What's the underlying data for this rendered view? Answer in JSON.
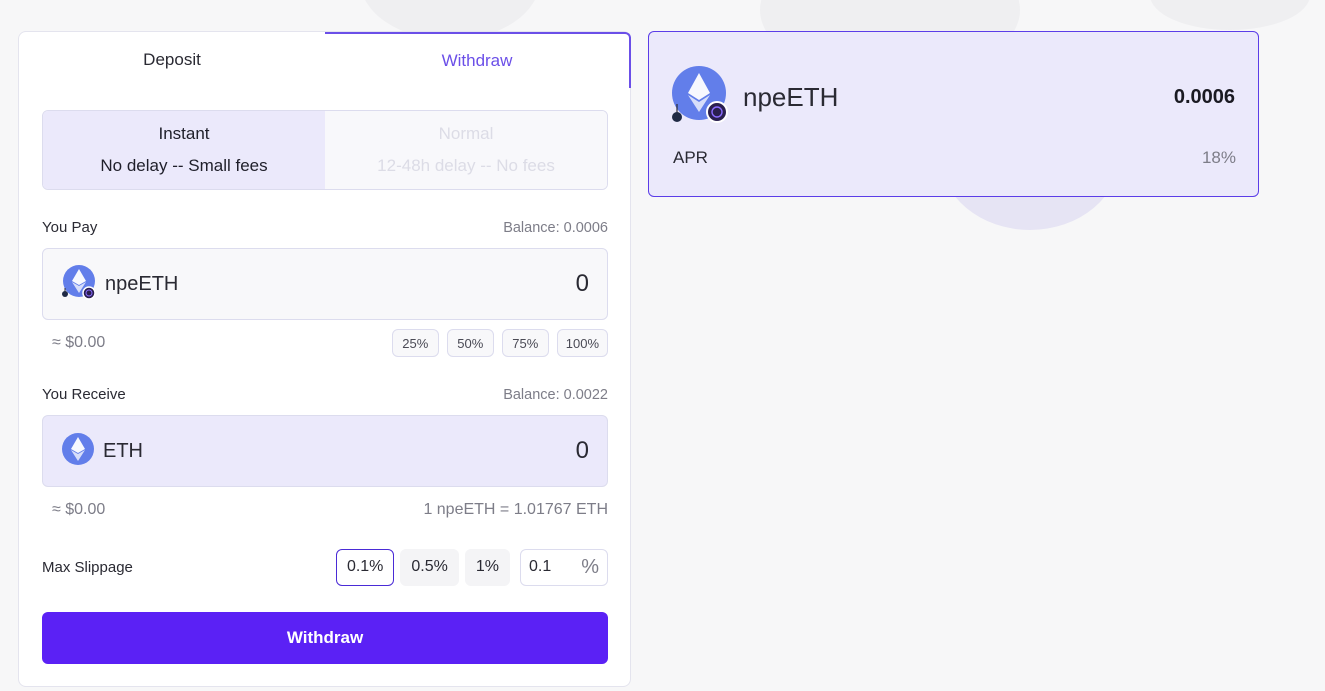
{
  "tabs": {
    "deposit": "Deposit",
    "withdraw": "Withdraw"
  },
  "mode": {
    "instant": {
      "title": "Instant",
      "subtitle": "No delay -- Small fees"
    },
    "normal": {
      "title": "Normal",
      "subtitle": "12-48h delay -- No fees"
    }
  },
  "pay": {
    "label": "You Pay",
    "balance": "Balance: 0.0006",
    "token": "npeETH",
    "amount": "0",
    "usd": "≈ $0.00",
    "percents": [
      "25%",
      "50%",
      "75%",
      "100%"
    ]
  },
  "receive": {
    "label": "You Receive",
    "balance": "Balance: 0.0022",
    "token": "ETH",
    "amount": "0",
    "usd": "≈ $0.00",
    "rate": "1 npeETH = 1.01767 ETH"
  },
  "slippage": {
    "label": "Max Slippage",
    "options": [
      "0.1%",
      "0.5%",
      "1%"
    ],
    "custom_value": "0.1",
    "custom_unit": "%"
  },
  "action": {
    "withdraw_label": "Withdraw"
  },
  "summary": {
    "token": "npeETH",
    "value": "0.0006",
    "apr_label": "APR",
    "apr_value": "18%"
  },
  "colors": {
    "accent": "#5b21f5",
    "accent_light": "#ebe9fb",
    "eth": "#627eea"
  }
}
